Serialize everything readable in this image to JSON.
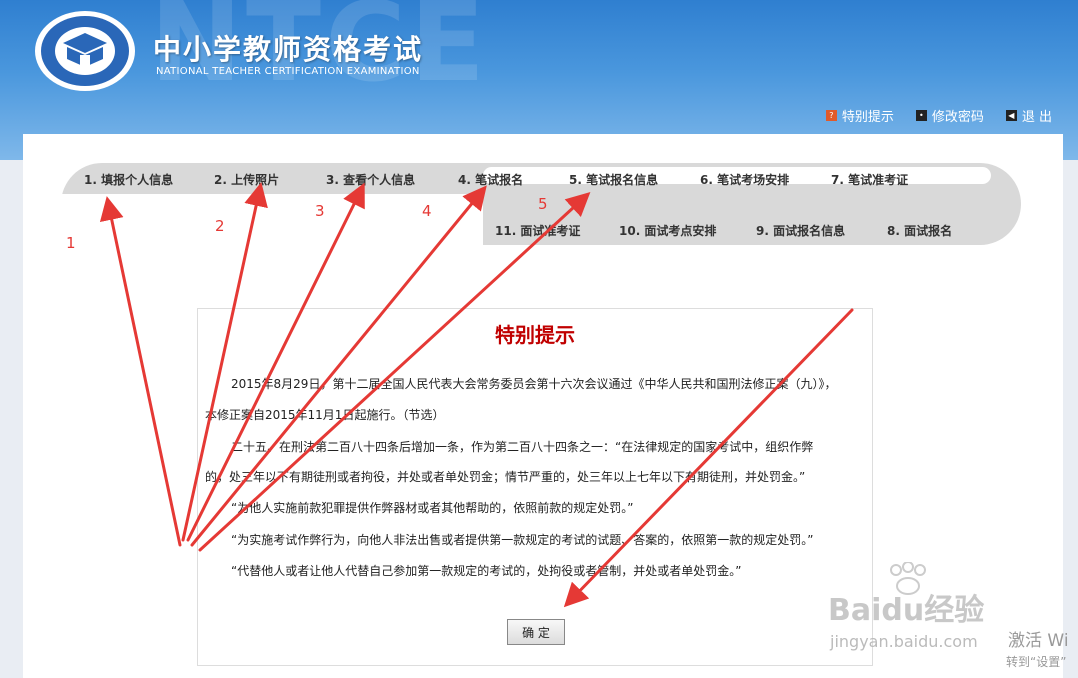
{
  "header": {
    "bg_text": "NTCE",
    "title": "中小学教师资格考试",
    "subtitle": "NATIONAL TEACHER CERTIFICATION EXAMINATION",
    "links": [
      {
        "label": "特别提示",
        "icon": "notice-icon"
      },
      {
        "label": "修改密码",
        "icon": "key-icon"
      },
      {
        "label": "退 出",
        "icon": "logout-icon"
      }
    ]
  },
  "steps": {
    "s1": "1. 填报个人信息",
    "s2": "2. 上传照片",
    "s3": "3. 查看个人信息",
    "s4": "4. 笔试报名",
    "s5": "5. 笔试报名信息",
    "s6": "6. 笔试考场安排",
    "s7": "7. 笔试准考证",
    "s8": "8. 面试报名",
    "s9": "9. 面试报名信息",
    "s10": "10. 面试考点安排",
    "s11": "11. 面试准考证"
  },
  "notice": {
    "title": "特别提示",
    "p1": "2015年8月29日，第十二届全国人民代表大会常务委员会第十六次会议通过《中华人民共和国刑法修正案（九）》，",
    "p2": "本修正案自2015年11月1日起施行。（节选）",
    "p3": "二十五、在刑法第二百八十四条后增加一条，作为第二百八十四条之一：“在法律规定的国家考试中，组织作弊",
    "p4": "的，处三年以下有期徒刑或者拘役，并处或者单处罚金；情节严重的，处三年以上七年以下有期徒刑，并处罚金。”",
    "p5": "“为他人实施前款犯罪提供作弊器材或者其他帮助的，依照前款的规定处罚。”",
    "p6": "“为实施考试作弊行为，向他人非法出售或者提供第一款规定的考试的试题、答案的，依照第一款的规定处罚。”",
    "p7": "“代替他人或者让他人代替自己参加第一款规定的考试的，处拘役或者管制，并处或者单处罚金。”",
    "ok": "确 定"
  },
  "annotations": [
    "1",
    "2",
    "3",
    "4",
    "5"
  ],
  "watermark": {
    "brand": "Baidu经验",
    "url": "jingyan.baidu.com",
    "activate1": "激活 Wi",
    "activate2": "转到“设置”"
  },
  "colors": {
    "header": "#3a8bd8",
    "accent_red": "#c00000",
    "arrow": "#e53935"
  }
}
